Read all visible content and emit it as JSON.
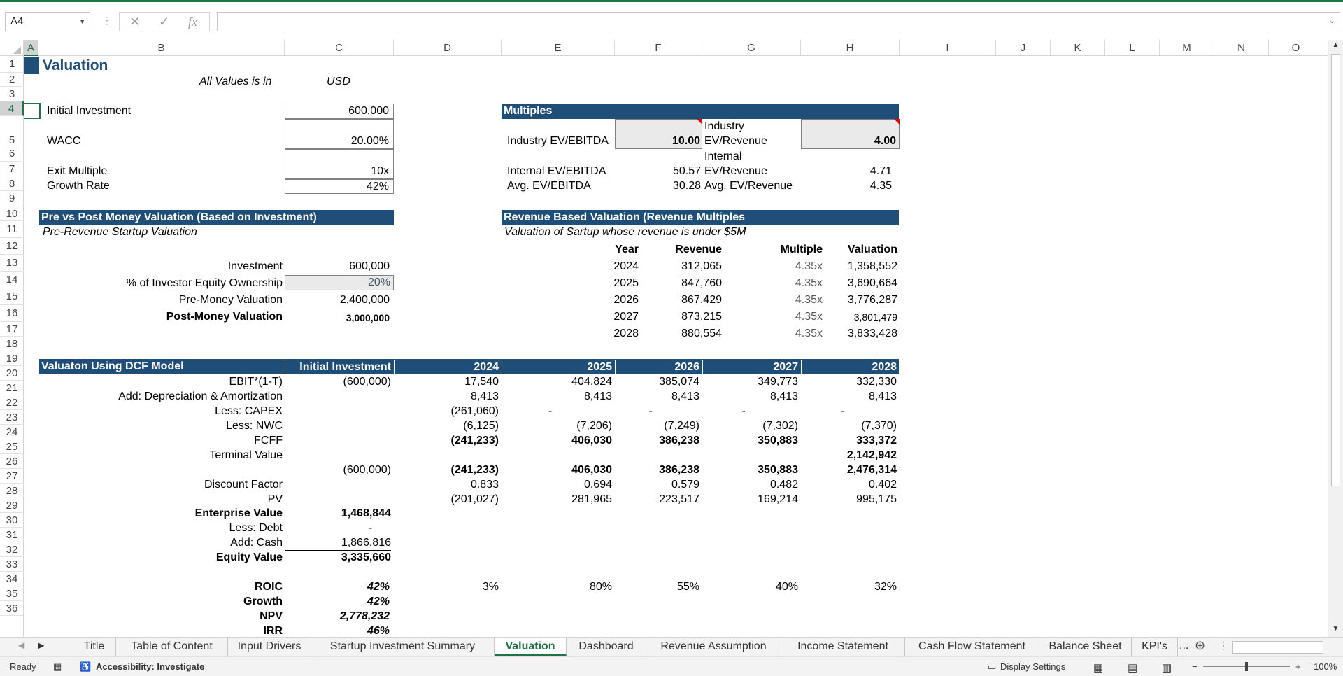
{
  "formula_bar": {
    "name_box": "A4",
    "cancel_icon": "✕",
    "enter_icon": "✓",
    "fx_label": "fx",
    "formula": ""
  },
  "columns": [
    "A",
    "B",
    "C",
    "D",
    "E",
    "F",
    "G",
    "H",
    "I",
    "J",
    "K",
    "L",
    "M",
    "N",
    "O"
  ],
  "rows": [
    "1",
    "2",
    "3",
    "4",
    "5",
    "6",
    "7",
    "8",
    "9",
    "10",
    "11",
    "12",
    "13",
    "14",
    "15",
    "16",
    "17",
    "18",
    "19",
    "20",
    "21",
    "22",
    "23",
    "24",
    "25",
    "26",
    "27",
    "28",
    "29",
    "30",
    "31",
    "32",
    "33",
    "34",
    "35",
    "36"
  ],
  "sheet": {
    "title": "Valuation",
    "values_note": "All Values is in",
    "currency": "USD",
    "inputs": [
      {
        "label": "Initial Investment",
        "value": "600,000"
      },
      {
        "label": "WACC",
        "value": "20.00%"
      },
      {
        "label": "Exit Multiple",
        "value": "10x"
      },
      {
        "label": "Growth Rate",
        "value": "42%"
      }
    ],
    "multiples": {
      "header": "Multiples",
      "industry_ev_ebitda_label": "Industry EV/EBITDA",
      "industry_ev_ebitda": "10.00",
      "industry_ev_rev_label_1": "Industry",
      "industry_ev_rev_label_2": "EV/Revenue",
      "industry_ev_rev": "4.00",
      "internal_ev_ebitda_label": "Internal EV/EBITDA",
      "internal_ev_ebitda": "50.57",
      "internal_ev_rev_label_1": "Internal",
      "internal_ev_rev_label_2": "EV/Revenue",
      "internal_ev_rev": "4.71",
      "avg_ev_ebitda_label": "Avg. EV/EBITDA",
      "avg_ev_ebitda": "30.28",
      "avg_ev_rev_label": "Avg. EV/Revenue",
      "avg_ev_rev": "4.35"
    },
    "prepost": {
      "header": "Pre vs Post Money Valuation (Based on Investment)",
      "subheader": "Pre-Revenue Startup Valuation",
      "investment_label": "Investment",
      "investment": "600,000",
      "equity_label": "% of Investor Equity Ownership",
      "equity": "20%",
      "pre_label": "Pre-Money Valuation",
      "pre": "2,400,000",
      "post_label": "Post-Money Valuation",
      "post": "3,000,000"
    },
    "revenue_valuation": {
      "header": "Revenue Based Valuation (Revenue Multiples",
      "subheader": "Valuation of Sartup whose revenue is under $5M",
      "col_headers": [
        "Year",
        "Revenue",
        "Multiple",
        "Valuation"
      ],
      "rows": [
        [
          "2024",
          "312,065",
          "4.35x",
          "1,358,552"
        ],
        [
          "2025",
          "847,760",
          "4.35x",
          "3,690,664"
        ],
        [
          "2026",
          "867,429",
          "4.35x",
          "3,776,287"
        ],
        [
          "2027",
          "873,215",
          "4.35x",
          "3,801,479"
        ],
        [
          "2028",
          "880,554",
          "4.35x",
          "3,833,428"
        ]
      ]
    },
    "dcf": {
      "header": "Valuaton Using DCF Model",
      "col_headers": [
        "Initial Investment",
        "2024",
        "2025",
        "2026",
        "2027",
        "2028"
      ],
      "rows": [
        {
          "label": "EBIT*(1-T)",
          "bold": false,
          "cells": [
            "(600,000)",
            "17,540",
            "404,824",
            "385,074",
            "349,773",
            "332,330"
          ]
        },
        {
          "label": "Add: Depreciation & Amortization",
          "bold": false,
          "cells": [
            "",
            "8,413",
            "8,413",
            "8,413",
            "8,413",
            "8,413"
          ]
        },
        {
          "label": "Less: CAPEX",
          "bold": false,
          "cells": [
            "",
            "(261,060)",
            "-",
            "-",
            "-",
            "-"
          ]
        },
        {
          "label": "Less: NWC",
          "bold": false,
          "cells": [
            "",
            "(6,125)",
            "(7,206)",
            "(7,249)",
            "(7,302)",
            "(7,370)"
          ]
        },
        {
          "label": "FCFF",
          "bold": false,
          "boldvals": true,
          "cells": [
            "",
            "(241,233)",
            "406,030",
            "386,238",
            "350,883",
            "333,372"
          ]
        },
        {
          "label": "Terminal Value",
          "bold": false,
          "boldvals": true,
          "cells": [
            "",
            "",
            "",
            "",
            "",
            "2,142,942"
          ]
        },
        {
          "label": "",
          "bold": false,
          "boldvals": true,
          "cells": [
            "(600,000)",
            "(241,233)",
            "406,030",
            "386,238",
            "350,883",
            "2,476,314"
          ]
        },
        {
          "label": "Discount Factor",
          "bold": false,
          "cells": [
            "",
            "0.833",
            "0.694",
            "0.579",
            "0.482",
            "0.402"
          ]
        },
        {
          "label": "PV",
          "bold": false,
          "cells": [
            "",
            "(201,027)",
            "281,965",
            "223,517",
            "169,214",
            "995,175"
          ]
        }
      ],
      "enterprise_value_label": "Enterprise Value",
      "enterprise_value": "1,468,844",
      "less_debt_label": "Less: Debt",
      "less_debt": "-",
      "add_cash_label": "Add: Cash",
      "add_cash": "1,866,816",
      "equity_value_label": "Equity Value",
      "equity_value": "3,335,660",
      "roic_label": "ROIC",
      "roic": "42%",
      "roic_years": [
        "3%",
        "80%",
        "55%",
        "40%",
        "32%"
      ],
      "growth_label": "Growth",
      "growth": "42%",
      "npv_label": "NPV",
      "npv": "2,778,232",
      "irr_label": "IRR",
      "irr": "46%"
    }
  },
  "tabs": [
    "Title",
    "Table of Content",
    "Input Drivers",
    "Startup Investment Summary",
    "Valuation",
    "Dashboard",
    "Revenue Assumption",
    "Income Statement",
    "Cash Flow Statement",
    "Balance Sheet",
    "KPI's"
  ],
  "tabs_more": "...",
  "active_tab": "Valuation",
  "status": {
    "ready": "Ready",
    "accessibility": "Accessibility: Investigate",
    "display_settings": "Display Settings",
    "zoom": "100%"
  }
}
